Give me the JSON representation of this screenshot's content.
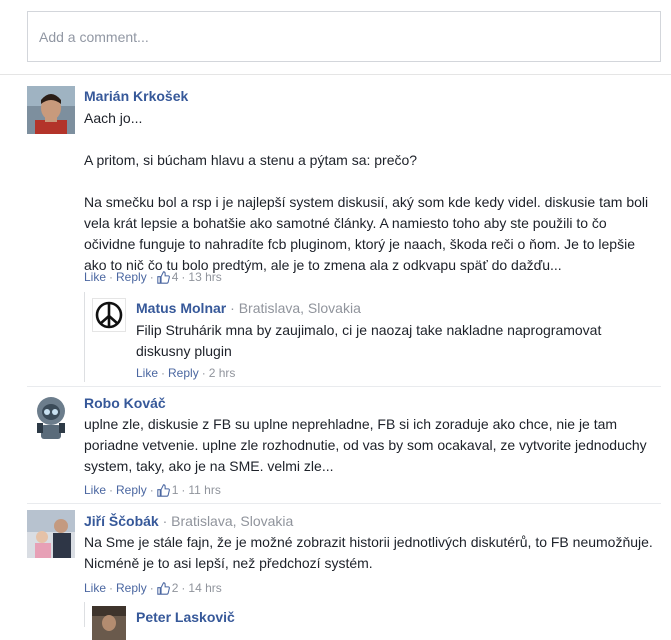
{
  "comment_input": {
    "placeholder": "Add a comment..."
  },
  "comments": [
    {
      "author": "Marián Krkošek",
      "location": "",
      "text": "Aach jo...\n\nA pritom, si búcham hlavu a stenu a pýtam sa: prečo?\n\nNa smečku bol a rsp i je najlepší system diskusií, aký som kde kedy videl. diskusie tam boli\nvela krát lepsie a bohatšie ako samotné články. A namiesto toho aby ste použili to čo\nočividne funguje to nahradíte fcb pluginom, ktorý je naach, škoda reči o ňom. Je to lepšie\nako to nič čo tu bolo predtým, ale je to zmena ala z odkvapu späť do dažďu...",
      "like": "Like",
      "reply": "Reply",
      "likes": "4",
      "time": "13 hrs"
    },
    {
      "author": "Matus Molnar",
      "location": "Bratislava, Slovakia",
      "text": "Filip Struhárik mna by zaujimalo, ci je naozaj take nakladne naprogramovat\ndiskusny plugin",
      "like": "Like",
      "reply": "Reply",
      "likes": "",
      "time": "2 hrs"
    },
    {
      "author": "Robo Kováč",
      "location": "",
      "text": "uplne zle, diskusie z FB su uplne neprehladne, FB si ich zoraduje ako chce, nie je tam\nporiadne vetvenie. uplne zle rozhodnutie, od vas by som ocakaval, ze vytvorite jednoduchy\nsystem, taky, ako je na SME. velmi zle...",
      "like": "Like",
      "reply": "Reply",
      "likes": "1",
      "time": "11 hrs"
    },
    {
      "author": "Jiří Ščobák",
      "location": "Bratislava, Slovakia",
      "text": "Na Sme je stále fajn, že je možné zobrazit historii jednotlivých diskutérů, to FB neumožňuje.\nNicméně je to asi lepší, než předchozí systém.",
      "like": "Like",
      "reply": "Reply",
      "likes": "2",
      "time": "14 hrs"
    },
    {
      "author": "Peter Laskovič",
      "location": "",
      "text": "",
      "like": "",
      "reply": "",
      "likes": "",
      "time": ""
    }
  ],
  "separator": "·",
  "colors": {
    "link": "#365899",
    "meta": "#90949c",
    "action": "#4b67a1",
    "border": "#d3d6db"
  }
}
